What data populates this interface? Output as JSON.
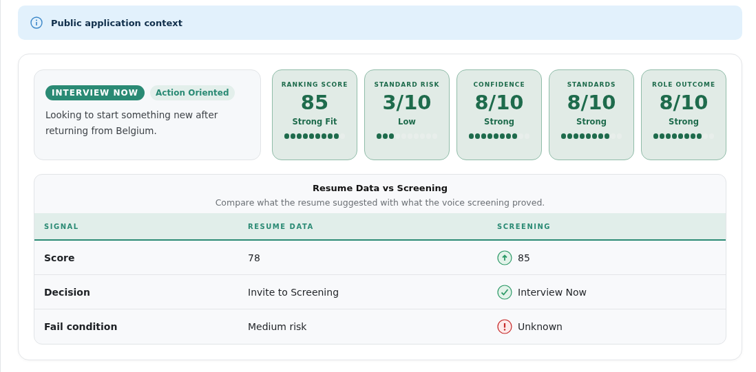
{
  "banner": {
    "text": "Public application context"
  },
  "summary": {
    "decision": "INTERVIEW NOW",
    "tag": "Action Oriented",
    "note": "Looking to start something new after returning from Belgium."
  },
  "metrics": [
    {
      "label": "RANKING SCORE",
      "value": "85",
      "caption": "Strong Fit",
      "level": 0.9
    },
    {
      "label": "STANDARD RISK",
      "value": "3/10",
      "caption": "Low",
      "level": 0.3
    },
    {
      "label": "CONFIDENCE",
      "value": "8/10",
      "caption": "Strong",
      "level": 0.8
    },
    {
      "label": "STANDARDS",
      "value": "8/10",
      "caption": "Strong",
      "level": 0.8
    },
    {
      "label": "ROLE OUTCOME",
      "value": "8/10",
      "caption": "Strong",
      "level": 0.8
    }
  ],
  "comparison": {
    "title": "Resume Data vs Screening",
    "subtitle": "Compare what the resume suggested with what the voice screening proved.",
    "columns": [
      "SIGNAL",
      "RESUME DATA",
      "SCREENING"
    ],
    "rows": [
      {
        "signal": "Score",
        "resume": "78",
        "screening": "85",
        "kind": "up"
      },
      {
        "signal": "Decision",
        "resume": "Invite to Screening",
        "screening": "Interview Now",
        "kind": "check"
      },
      {
        "signal": "Fail condition",
        "resume": "Medium risk",
        "screening": "Unknown",
        "kind": "alert"
      }
    ]
  }
}
